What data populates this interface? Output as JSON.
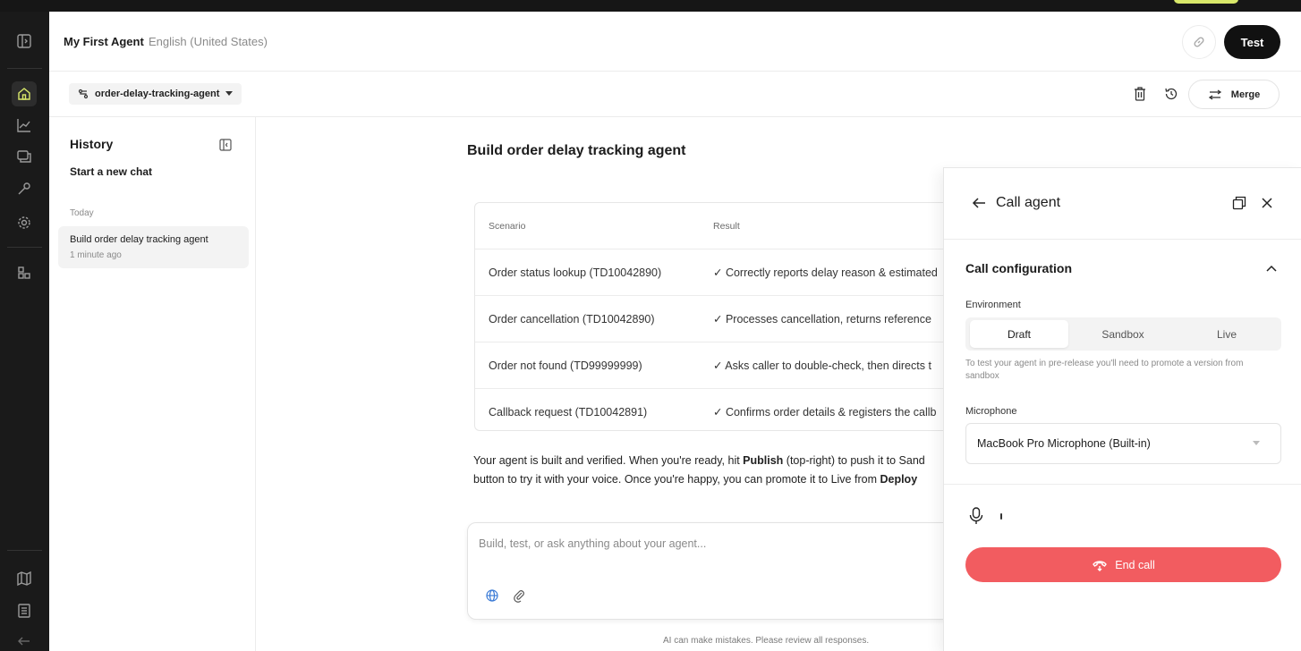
{
  "header": {
    "agent_name": "My First Agent",
    "language": "English (United States)",
    "test_label": "Test"
  },
  "toolbar": {
    "branch_name": "order-delay-tracking-agent",
    "merge_label": "Merge"
  },
  "history": {
    "title": "History",
    "new_chat": "Start a new chat",
    "group_label": "Today",
    "items": [
      {
        "title": "Build order delay tracking agent",
        "time": "1 minute ago"
      }
    ]
  },
  "chat": {
    "title": "Build order delay tracking agent",
    "table": {
      "headers": [
        "Scenario",
        "Result"
      ],
      "rows": [
        [
          "Order status lookup (TD10042890)",
          "✓ Correctly reports delay reason & estimated"
        ],
        [
          "Order cancellation (TD10042890)",
          "✓ Processes cancellation, returns reference"
        ],
        [
          "Order not found (TD99999999)",
          "✓ Asks caller to double-check, then directs t"
        ],
        [
          "Callback request (TD10042891)",
          "✓ Confirms order details & registers the callb"
        ]
      ]
    },
    "message": {
      "line1_a": "Your agent is built and verified. When you're ready, hit ",
      "line1_bold": "Publish",
      "line1_b": " (top-right) to push it to Sand",
      "line2_a": "button to try it with your voice. Once you're happy, you can promote it to Live from ",
      "line2_bold": "Deploy"
    },
    "input_placeholder": "Build, test, or ask anything about your agent...",
    "disclaimer": "AI can make mistakes. Please review all responses."
  },
  "call_panel": {
    "title": "Call agent",
    "config_title": "Call configuration",
    "environment_label": "Environment",
    "environments": [
      "Draft",
      "Sandbox",
      "Live"
    ],
    "selected_environment": "Draft",
    "hint": "To test your agent in pre-release you'll need to promote a version from sandbox",
    "microphone_label": "Microphone",
    "microphone_value": "MacBook Pro Microphone (Built-in)",
    "end_call_label": "End call",
    "end_call_color": "#f25c60"
  },
  "icons": {
    "rail": [
      "sidebar-toggle-icon",
      "home-icon",
      "analytics-icon",
      "conversations-icon",
      "tools-icon",
      "settings-icon",
      "apps-icon",
      "map-icon",
      "docs-icon",
      "back-arrow-icon"
    ],
    "accent": "#d9e86a"
  }
}
